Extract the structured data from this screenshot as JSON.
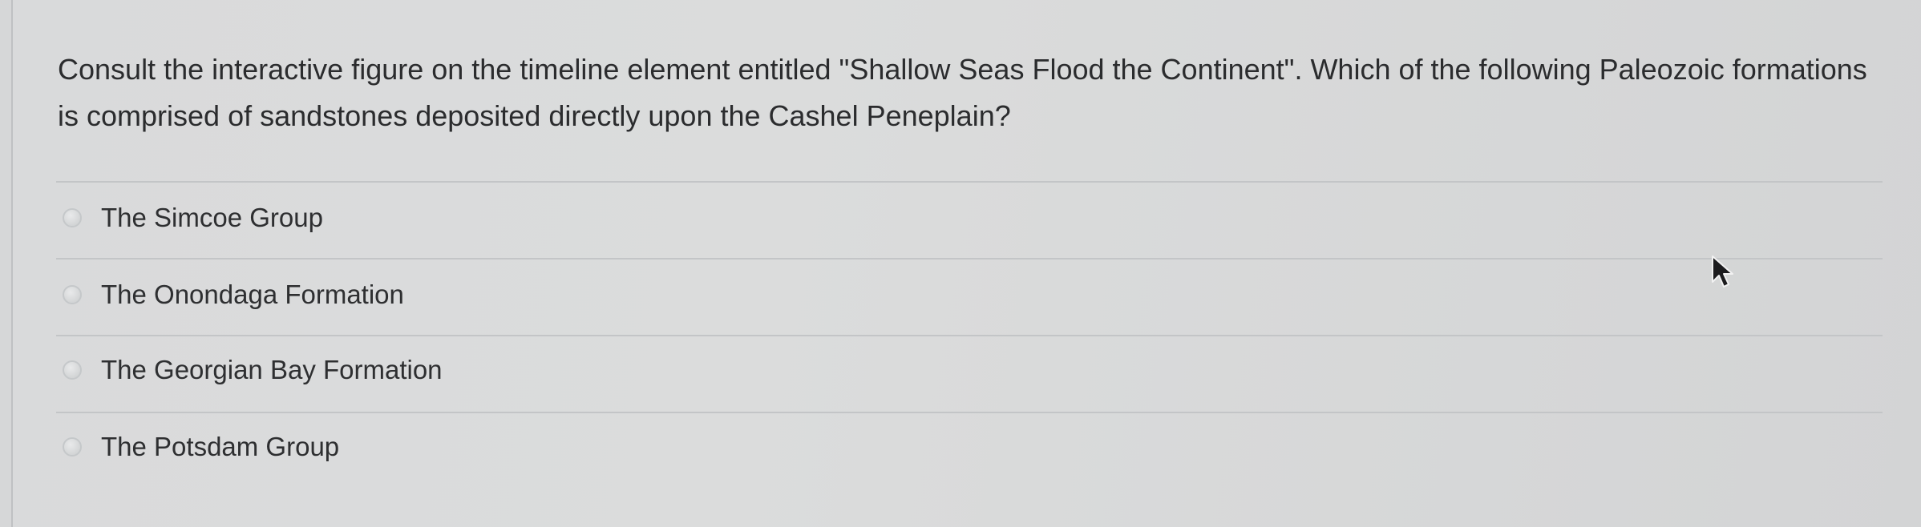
{
  "question": {
    "text": "Consult the interactive figure on the timeline element entitled \"Shallow Seas Flood the Continent\". Which of the following Paleozoic formations is comprised of sandstones deposited directly upon the Cashel Peneplain?"
  },
  "options": [
    {
      "label": "The Simcoe Group",
      "selected": false
    },
    {
      "label": "The Onondaga Formation",
      "selected": false
    },
    {
      "label": "The Georgian Bay Formation",
      "selected": false
    },
    {
      "label": "The Potsdam Group",
      "selected": false
    }
  ],
  "icons": {
    "cursor": "mouse-pointer-icon",
    "radio": "radio-button-icon"
  },
  "colors": {
    "background": "#d6d7d8",
    "text": "#2b2c2e",
    "divider": "#c3c5c7"
  }
}
